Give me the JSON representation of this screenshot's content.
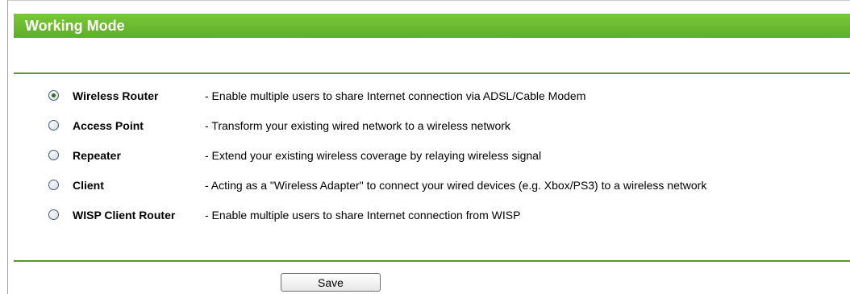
{
  "header": {
    "title": "Working Mode"
  },
  "options": [
    {
      "label": "Wireless Router",
      "description": "- Enable multiple users to share Internet connection via ADSL/Cable Modem",
      "selected": true
    },
    {
      "label": "Access Point",
      "description": "- Transform your existing wired network to a wireless network",
      "selected": false
    },
    {
      "label": "Repeater",
      "description": "- Extend your existing wireless coverage by relaying wireless signal",
      "selected": false
    },
    {
      "label": "Client",
      "description": "- Acting as a \"Wireless Adapter\" to connect your wired devices (e.g. Xbox/PS3) to a wireless network",
      "selected": false
    },
    {
      "label": "WISP Client Router",
      "description": "- Enable multiple users to share Internet connection from WISP",
      "selected": false
    }
  ],
  "actions": {
    "save_label": "Save"
  },
  "colors": {
    "header_green": "#6bbb31",
    "divider_green": "#5b9a2a"
  }
}
